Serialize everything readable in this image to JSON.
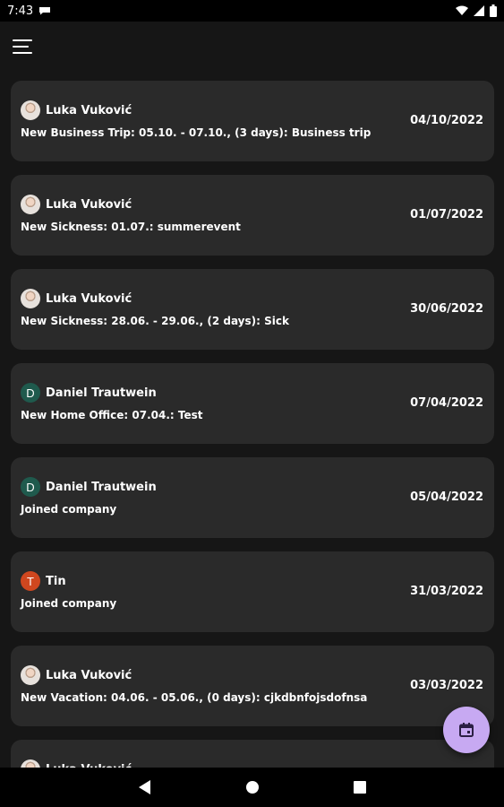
{
  "status_bar": {
    "time": "7:43",
    "left_icon": "messenger-icon",
    "right_icons": [
      "wifi-icon",
      "signal-icon",
      "battery-icon"
    ]
  },
  "app_bar": {
    "menu_icon": "hamburger-menu-icon"
  },
  "feed": {
    "items": [
      {
        "avatar_type": "photo",
        "avatar_letter": "",
        "name": "Luka Vuković",
        "description": "New Business Trip: 05.10. - 07.10., (3 days): Business trip",
        "date": "04/10/2022"
      },
      {
        "avatar_type": "photo",
        "avatar_letter": "",
        "name": "Luka Vuković",
        "description": "New Sickness: 01.07.: summerevent",
        "date": "01/07/2022"
      },
      {
        "avatar_type": "photo",
        "avatar_letter": "",
        "name": "Luka Vuković",
        "description": "New Sickness: 28.06. - 29.06., (2 days): Sick",
        "date": "30/06/2022"
      },
      {
        "avatar_type": "letter",
        "avatar_letter": "D",
        "avatar_color": "#1f5a4d",
        "name": "Daniel Trautwein",
        "description": "New Home Office: 07.04.: Test",
        "date": "07/04/2022"
      },
      {
        "avatar_type": "letter",
        "avatar_letter": "D",
        "avatar_color": "#1f5a4d",
        "name": "Daniel Trautwein",
        "description": "Joined company",
        "date": "05/04/2022"
      },
      {
        "avatar_type": "letter",
        "avatar_letter": "T",
        "avatar_color": "#d0471f",
        "name": "Tin",
        "description": "Joined company",
        "date": "31/03/2022"
      },
      {
        "avatar_type": "photo",
        "avatar_letter": "",
        "name": "Luka Vuković",
        "description": "New Vacation: 04.06. - 05.06., (0 days): cjkdbnfojsdofnsa",
        "date": "03/03/2022"
      },
      {
        "avatar_type": "photo",
        "avatar_letter": "",
        "name": "Luka Vuković",
        "description": "",
        "date": ""
      }
    ]
  },
  "fab": {
    "icon": "calendar-icon",
    "color": "#c7a9f2"
  },
  "nav_bar": {
    "icons": [
      "back-icon",
      "home-icon",
      "recents-icon"
    ]
  },
  "colors": {
    "background": "#161616",
    "card": "#2a2a2a",
    "text": "#ffffff"
  }
}
